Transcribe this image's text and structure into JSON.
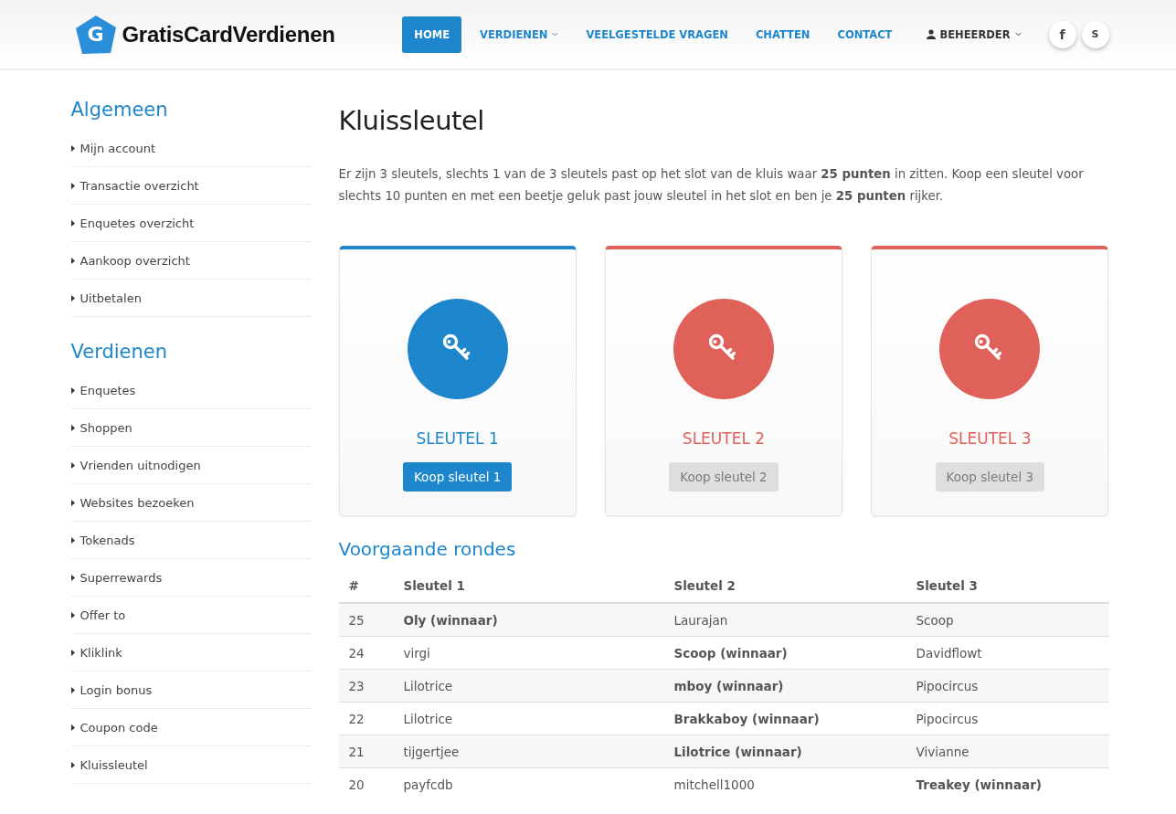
{
  "header": {
    "logo_letter": "G",
    "logo_text": "GratisCardVerdienen",
    "nav": [
      {
        "label": "HOME",
        "selected": true,
        "dropdown": false,
        "kind": "link"
      },
      {
        "label": "VERDIENEN",
        "selected": false,
        "dropdown": true,
        "kind": "link"
      },
      {
        "label": "VEELGESTELDE VRAGEN",
        "selected": false,
        "dropdown": false,
        "kind": "link"
      },
      {
        "label": "CHATTEN",
        "selected": false,
        "dropdown": false,
        "kind": "link"
      },
      {
        "label": "CONTACT",
        "selected": false,
        "dropdown": false,
        "kind": "link"
      },
      {
        "label": "BEHEERDER",
        "selected": false,
        "dropdown": true,
        "kind": "user"
      }
    ],
    "social": [
      {
        "label": "f",
        "kind": "facebook"
      },
      {
        "label": "S",
        "kind": "skype"
      }
    ]
  },
  "sidebar": [
    {
      "title": "Algemeen",
      "items": [
        {
          "label": "Mijn account"
        },
        {
          "label": "Transactie overzicht"
        },
        {
          "label": "Enquetes overzicht"
        },
        {
          "label": "Aankoop overzicht"
        },
        {
          "label": "Uitbetalen"
        }
      ]
    },
    {
      "title": "Verdienen",
      "items": [
        {
          "label": "Enquetes"
        },
        {
          "label": "Shoppen"
        },
        {
          "label": "Vrienden uitnodigen"
        },
        {
          "label": "Websites bezoeken"
        },
        {
          "label": "Tokenads"
        },
        {
          "label": "Superrewards"
        },
        {
          "label": "Offer to"
        },
        {
          "label": "Kliklink"
        },
        {
          "label": "Login bonus"
        },
        {
          "label": "Coupon code"
        },
        {
          "label": "Kluissleutel"
        }
      ]
    }
  ],
  "main": {
    "title": "Kluissleutel",
    "intro": "Er zijn 3 sleutels, slechts 1 van de 3 sleutels past op het slot van de kluis waar **25 punten** in zitten. Koop een sleutel voor slechts 10 punten en met een beetje geluk past jouw sleutel in het slot en ben je **25 punten** rijker.",
    "keys": [
      {
        "title": "SLEUTEL 1",
        "button": "Koop sleutel 1",
        "selected": true,
        "disabled": false
      },
      {
        "title": "SLEUTEL 2",
        "button": "Koop sleutel 2",
        "selected": false,
        "disabled": true
      },
      {
        "title": "SLEUTEL 3",
        "button": "Koop sleutel 3",
        "selected": false,
        "disabled": true
      }
    ],
    "rounds_title": "Voorgaande rondes",
    "table": {
      "columns": [
        "#",
        "Sleutel 1",
        "Sleutel 2",
        "Sleutel 3"
      ],
      "rows": [
        {
          "cells": [
            {
              "text": "25",
              "winner": false
            },
            {
              "text": "Oly (winnaar)",
              "winner": true
            },
            {
              "text": "Laurajan",
              "winner": false
            },
            {
              "text": "Scoop",
              "winner": false
            }
          ]
        },
        {
          "cells": [
            {
              "text": "24",
              "winner": false
            },
            {
              "text": "virgi",
              "winner": false
            },
            {
              "text": "Scoop (winnaar)",
              "winner": true
            },
            {
              "text": "Davidflowt",
              "winner": false
            }
          ]
        },
        {
          "cells": [
            {
              "text": "23",
              "winner": false
            },
            {
              "text": "Lilotrice",
              "winner": false
            },
            {
              "text": "mboy (winnaar)",
              "winner": true
            },
            {
              "text": "Pipocircus",
              "winner": false
            }
          ]
        },
        {
          "cells": [
            {
              "text": "22",
              "winner": false
            },
            {
              "text": "Lilotrice",
              "winner": false
            },
            {
              "text": "Brakkaboy (winnaar)",
              "winner": true
            },
            {
              "text": "Pipocircus",
              "winner": false
            }
          ]
        },
        {
          "cells": [
            {
              "text": "21",
              "winner": false
            },
            {
              "text": "tijgertjee",
              "winner": false
            },
            {
              "text": "Lilotrice (winnaar)",
              "winner": true
            },
            {
              "text": "Vivianne",
              "winner": false
            }
          ]
        },
        {
          "cells": [
            {
              "text": "20",
              "winner": false
            },
            {
              "text": "payfcdb",
              "winner": false
            },
            {
              "text": "mitchell1000",
              "winner": false
            },
            {
              "text": "Treakey (winnaar)",
              "winner": true
            }
          ]
        }
      ]
    }
  }
}
